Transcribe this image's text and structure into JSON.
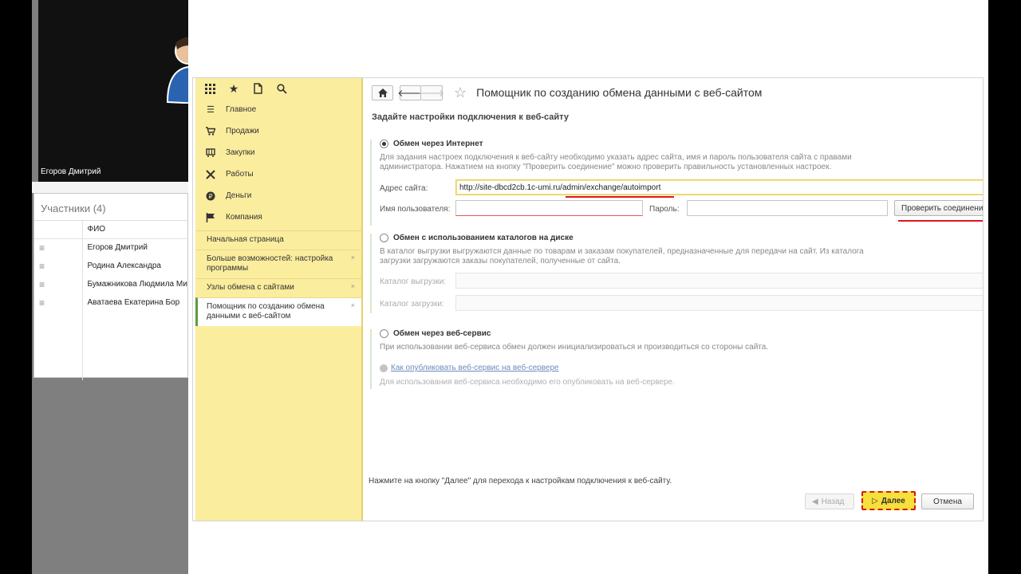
{
  "conference": {
    "speaker_name": "Егоров Дмитрий",
    "participants_title": "Участники (4)",
    "column_fio": "ФИО",
    "participants": [
      {
        "name": "Егоров Дмитрий"
      },
      {
        "name": "Родина Александра"
      },
      {
        "name": "Бумажникова Людмила Ми"
      },
      {
        "name": "Аватаева Екатерина Бор"
      }
    ]
  },
  "sidebar": {
    "menu": [
      {
        "icon": "list-icon",
        "glyph": "≣",
        "label": "Главное"
      },
      {
        "icon": "cart-icon",
        "glyph": "⛟",
        "label": "Продажи"
      },
      {
        "icon": "purchase-cart-icon",
        "glyph": "▦",
        "label": "Закупки"
      },
      {
        "icon": "tools-icon",
        "glyph": "✕",
        "label": "Работы"
      },
      {
        "icon": "coin-icon",
        "glyph": "●",
        "label": "Деньги"
      },
      {
        "icon": "flag-icon",
        "glyph": "⚑",
        "label": "Компания"
      }
    ],
    "open_pages": [
      {
        "label": "Начальная страница",
        "closable": false
      },
      {
        "label": "Больше возможностей: настройка программы",
        "closable": true
      },
      {
        "label": "Узлы обмена с сайтами",
        "closable": true
      },
      {
        "label": "Помощник по созданию обмена данными с веб-сайтом",
        "closable": true
      }
    ]
  },
  "form": {
    "title": "Помощник по созданию обмена данными с веб-сайтом",
    "subtitle": "Задайте настройки подключения к веб-сайту",
    "option_internet": {
      "label": "Обмен через Интернет",
      "checked": true,
      "note": "Для задания настроек подключения к веб-сайту необходимо указать адрес сайта, имя и пароль пользователя сайта с правами администратора. Нажатием на кнопку \"Проверить соединение\" можно проверить правильность установленных настроек.",
      "site_address_label": "Адрес сайта:",
      "site_address_value": "http://site-dbcd2cb.1c-umi.ru/admin/exchange/autoimport",
      "username_label": "Имя пользователя:",
      "username_value": "",
      "password_label": "Пароль:",
      "password_value": "",
      "check_button": "Проверить соединение"
    },
    "option_catalogs": {
      "label": "Обмен с использованием каталогов на диске",
      "checked": false,
      "note": "В каталог выгрузки выгружаются данные по товарам и заказам покупателей, предназначенные для передачи на сайт. Из каталога загрузки загружаются заказы покупателей, полученные от сайта.",
      "export_dir_label": "Каталог выгрузки:",
      "import_dir_label": "Каталог загрузки:"
    },
    "option_webservice": {
      "label": "Обмен через веб-сервис",
      "checked": false,
      "note": "При использовании веб-сервиса обмен должен инициализироваться и производиться со стороны сайта.",
      "link": "Как опубликовать веб-сервис на веб-сервере",
      "hint": "Для использования веб-сервиса необходимо его опубликовать на веб-сервере."
    },
    "footer_note": "Нажмите на кнопку \"Далее\" для перехода к настройкам подключения к веб-сайту.",
    "buttons": {
      "back": "Назад",
      "next": "Далее",
      "cancel": "Отмена"
    }
  },
  "colors": {
    "sidebar_bg": "#fbed9e",
    "next_button": "#f7e03b",
    "highlight_red": "#e0151b"
  }
}
